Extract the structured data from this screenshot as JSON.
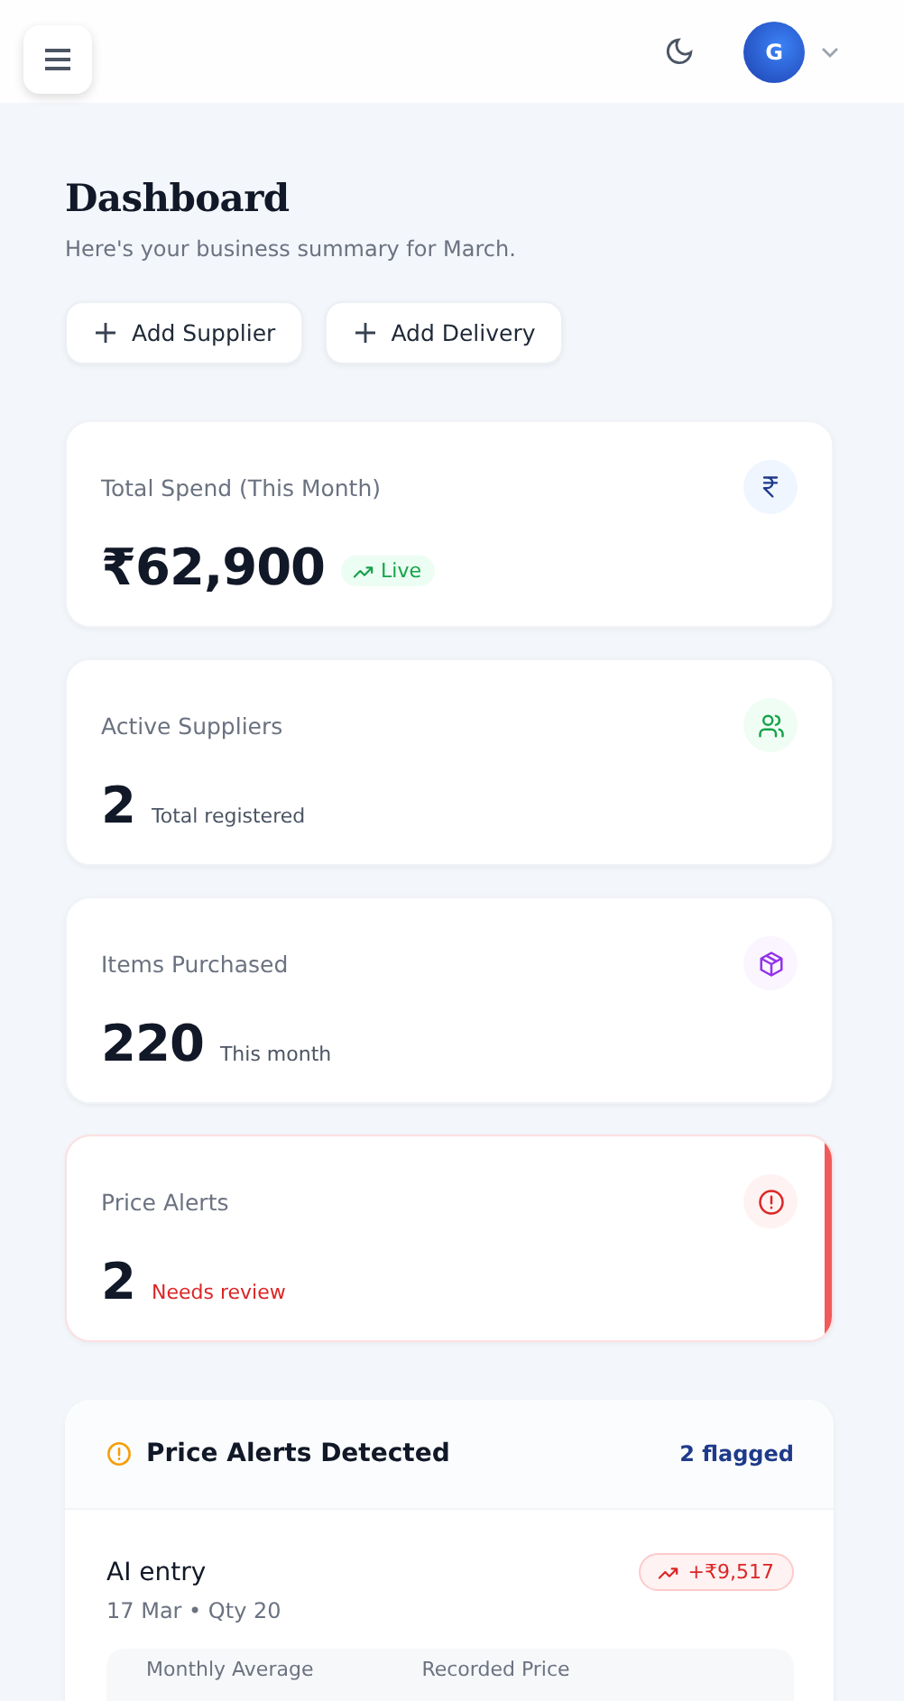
{
  "header": {
    "avatar_initial": "G"
  },
  "page": {
    "title": "Dashboard",
    "subtitle": "Here's your business summary for March."
  },
  "actions": [
    {
      "label": "Add Supplier"
    },
    {
      "label": "Add Delivery"
    }
  ],
  "stats": [
    {
      "label": "Total Spend (This Month)",
      "kind": "rupee",
      "value": "₹62,900",
      "note": {
        "text": "Live",
        "kind": "badge"
      },
      "alert": false
    },
    {
      "label": "Active Suppliers",
      "kind": "users",
      "value": "2",
      "note": {
        "text": "Total registered",
        "kind": "plain"
      },
      "alert": false
    },
    {
      "label": "Items Purchased",
      "kind": "box",
      "value": "220",
      "note": {
        "text": "This month",
        "kind": "plain"
      },
      "alert": false
    },
    {
      "label": "Price Alerts",
      "kind": "alert",
      "value": "2",
      "note": {
        "text": "Needs review",
        "kind": "danger"
      },
      "alert": true
    }
  ],
  "alerts_panel": {
    "title": "Price Alerts Detected",
    "count": "2 flagged",
    "items": [
      {
        "name": "AI entry",
        "meta": "17 Mar • Qty 20",
        "change": "+₹9,517",
        "columns": [
          "Monthly Average",
          "Recorded Price"
        ]
      }
    ]
  }
}
